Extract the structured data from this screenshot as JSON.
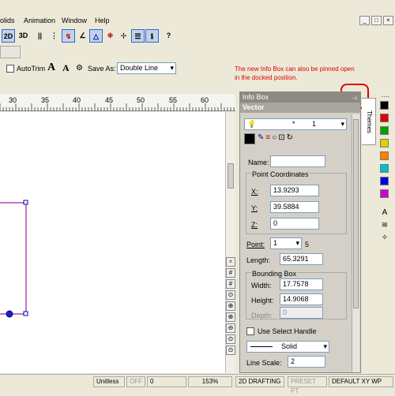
{
  "menu": [
    "olids",
    "Animation",
    "Window",
    "Help"
  ],
  "window_buttons": [
    "_",
    "□",
    "×"
  ],
  "toolbar1_buttons": [
    {
      "icon": "2d-icon",
      "label": "2D"
    },
    {
      "icon": "3d-icon",
      "label": "3D"
    }
  ],
  "toolbar2": {
    "autotrim_label": "AutoTrim",
    "save_as_label": "Save As:",
    "double_line_value": "Double Line"
  },
  "note": "The new Info Box can also be pinned open in the docked position.",
  "ruler_ticks": [
    "30",
    "35",
    "40",
    "45",
    "50",
    "55",
    "60"
  ],
  "info_box": {
    "title": "Info Box",
    "pin_icon": "pin-icon",
    "subtitle": "Vector",
    "layer_value": "1",
    "layer_star": "*",
    "name_label": "Name:",
    "name_value": "",
    "point_coords_label": "Point Coordinates",
    "x_label": "X:",
    "x_value": "13.9293",
    "y_label": "Y:",
    "y_value": "39.5884",
    "z_label": "Z:",
    "z_value": "0",
    "point_label": "Point:",
    "point_value": "1",
    "point_count": "5",
    "length_label": "Length:",
    "length_value": "65.3291",
    "bounding_label": "Bounding Box",
    "width_label": "Width:",
    "width_value": "17.7578",
    "height_label": "Height:",
    "height_value": "14.9068",
    "depth_label": "Depth:",
    "depth_value": "0",
    "select_handle_label": "Use Select Handle",
    "line_style_value": "Solid",
    "line_scale_label": "Line Scale:",
    "line_scale_value": "2"
  },
  "themes_tab": "Themes",
  "swatch_colors": [
    "#000000",
    "#e00000",
    "#00a000",
    "#e0d000",
    "#ff8000",
    "#00c0c0",
    "#0000e0",
    "#d000d0"
  ],
  "status": {
    "units": "Unitless",
    "off": "OFF",
    "zero": "0",
    "zoom": "153%",
    "mode": "2D DRAFTING",
    "preset": "PRESET PT",
    "view": "DEFAULT XY WP"
  }
}
